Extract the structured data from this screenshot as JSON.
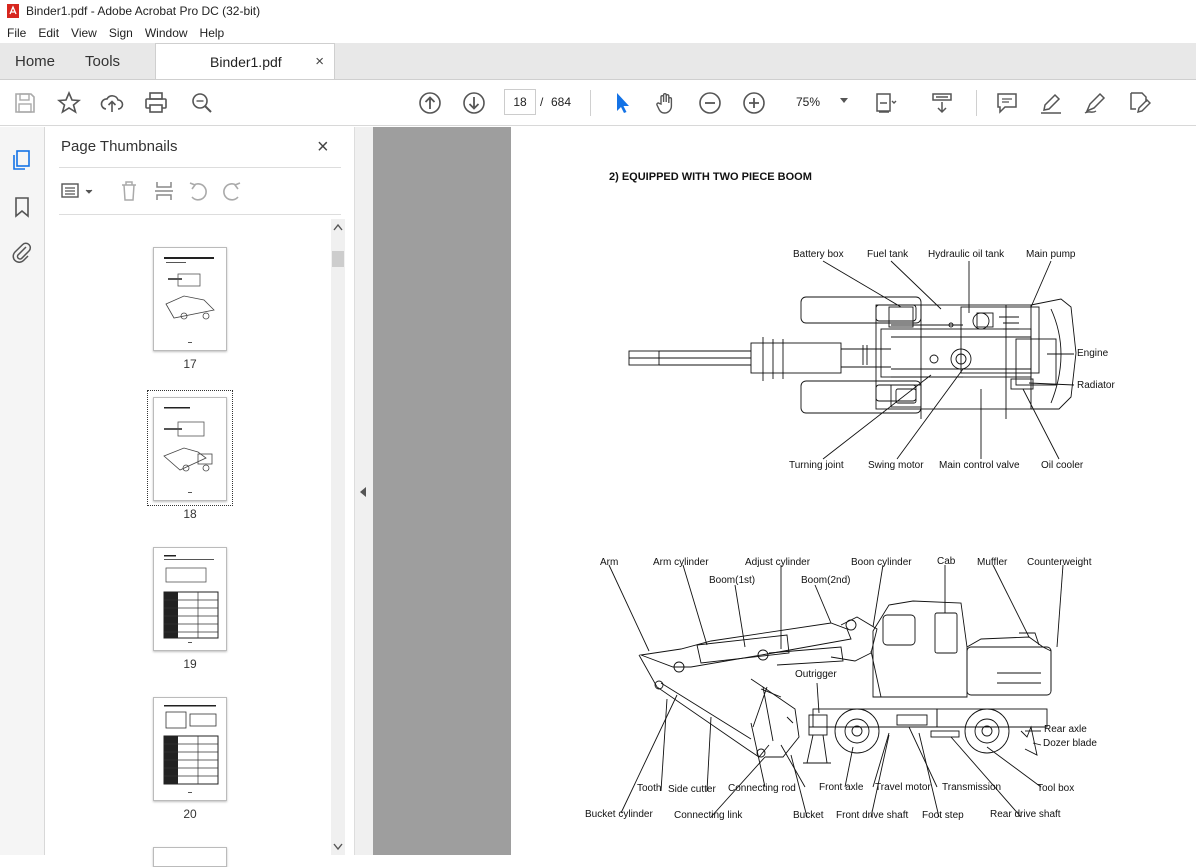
{
  "window": {
    "title": "Binder1.pdf - Adobe Acrobat Pro DC (32-bit)"
  },
  "menu": [
    "File",
    "Edit",
    "View",
    "Sign",
    "Window",
    "Help"
  ],
  "tabs": {
    "home": "Home",
    "tools": "Tools",
    "document": "Binder1.pdf",
    "close": "×"
  },
  "toolbar": {
    "current_page": "18",
    "page_separator": "/",
    "total_pages": "684",
    "zoom": "75%"
  },
  "panel": {
    "title": "Page Thumbnails",
    "close": "×",
    "thumbnails": [
      {
        "label": "17"
      },
      {
        "label": "18",
        "selected": true
      },
      {
        "label": "19"
      },
      {
        "label": "20"
      }
    ]
  },
  "document": {
    "heading": "2) EQUIPPED WITH TWO PIECE BOOM",
    "top_labels": {
      "battery_box": "Battery box",
      "fuel_tank": "Fuel tank",
      "hydraulic_oil_tank": "Hydraulic oil tank",
      "main_pump": "Main pump",
      "engine": "Engine",
      "radiator": "Radiator",
      "turning_joint": "Turning joint",
      "swing_motor": "Swing motor",
      "main_control_valve": "Main control valve",
      "oil_cooler": "Oil cooler"
    },
    "side_labels": {
      "arm": "Arm",
      "arm_cylinder": "Arm cylinder",
      "adjust_cylinder": "Adjust cylinder",
      "boon_cylinder": "Boon cylinder",
      "cab": "Cab",
      "muffler": "Muffler",
      "counterweight": "Counterweight",
      "boom_1st": "Boom(1st)",
      "boom_2nd": "Boom(2nd)",
      "outrigger": "Outrigger",
      "rear_axle": "Rear axle",
      "dozer_blade": "Dozer blade",
      "tooth": "Tooth",
      "side_cutter": "Side cutter",
      "connecting_rod": "Connecting rod",
      "front_axle": "Front axle",
      "travel_motor": "Travel motor",
      "transmission": "Transmission",
      "tool_box": "Tool box",
      "bucket_cylinder": "Bucket cylinder",
      "connecting_link": "Connecting link",
      "bucket": "Bucket",
      "front_drive_shaft": "Front drive shaft",
      "foot_step": "Foot step",
      "rear_drive_shaft": "Rear drive shaft"
    }
  }
}
